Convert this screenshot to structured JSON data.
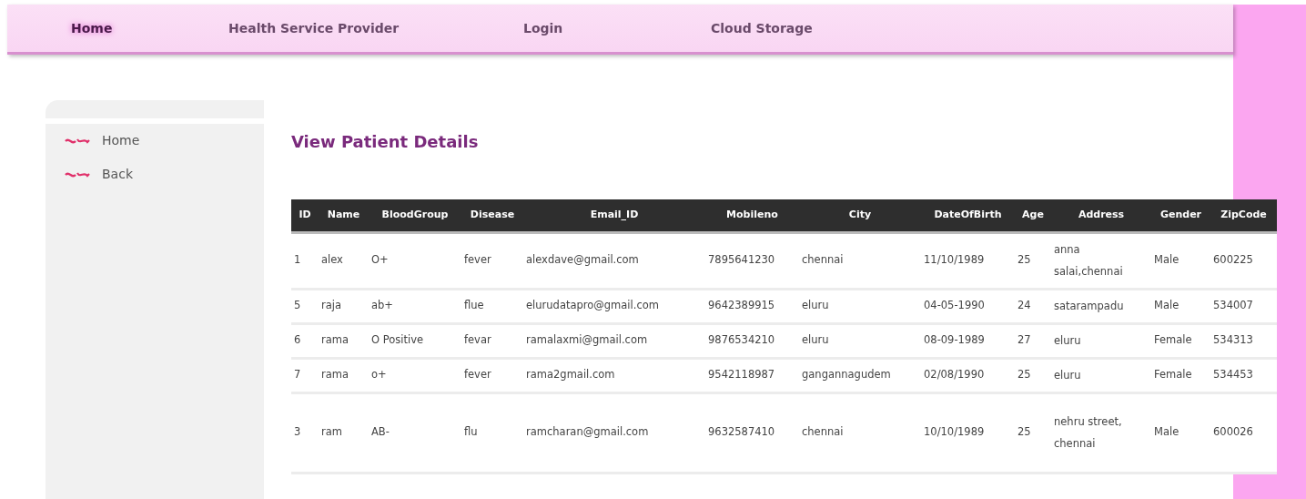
{
  "nav": [
    {
      "label": "Home",
      "selected": true
    },
    {
      "label": "Health Service Provider",
      "selected": false
    },
    {
      "label": "Login",
      "selected": false
    },
    {
      "label": "Cloud Storage",
      "selected": false
    }
  ],
  "sidebar": {
    "items": [
      {
        "label": "Home"
      },
      {
        "label": "Back"
      }
    ]
  },
  "page_title": "View Patient Details",
  "table": {
    "columns": [
      "ID",
      "Name",
      "BloodGroup",
      "Disease",
      "Email_ID",
      "Mobileno",
      "City",
      "DateOfBirth",
      "Age",
      "Address",
      "Gender",
      "ZipCode"
    ],
    "rows": [
      [
        "1",
        "alex",
        "O+",
        "fever",
        "alexdave@gmail.com",
        "7895641230",
        "chennai",
        "11/10/1989",
        "25",
        "anna salai,chennai",
        "Male",
        "600225"
      ],
      [
        "5",
        "raja",
        "ab+",
        "flue",
        "elurudatapro@gmail.com",
        "9642389915",
        "eluru",
        "04-05-1990",
        "24",
        "satarampadu",
        "Male",
        "534007"
      ],
      [
        "6",
        "rama",
        "O Positive",
        "fevar",
        "ramalaxmi@gmail.com",
        "9876534210",
        "eluru",
        "08-09-1989",
        "27",
        "eluru",
        "Female",
        "534313"
      ],
      [
        "7",
        "rama",
        "o+",
        "fever",
        "rama2gmail.com",
        "9542118987",
        "gangannagudem",
        "02/08/1990",
        "25",
        "eluru",
        "Female",
        "534453"
      ],
      [
        "3",
        "ram",
        "AB-",
        "flu",
        "ramcharan@gmail.com",
        "9632587410",
        "chennai",
        "10/10/1989",
        "25",
        "nehru street, chennai",
        "Male",
        "600026"
      ]
    ]
  }
}
